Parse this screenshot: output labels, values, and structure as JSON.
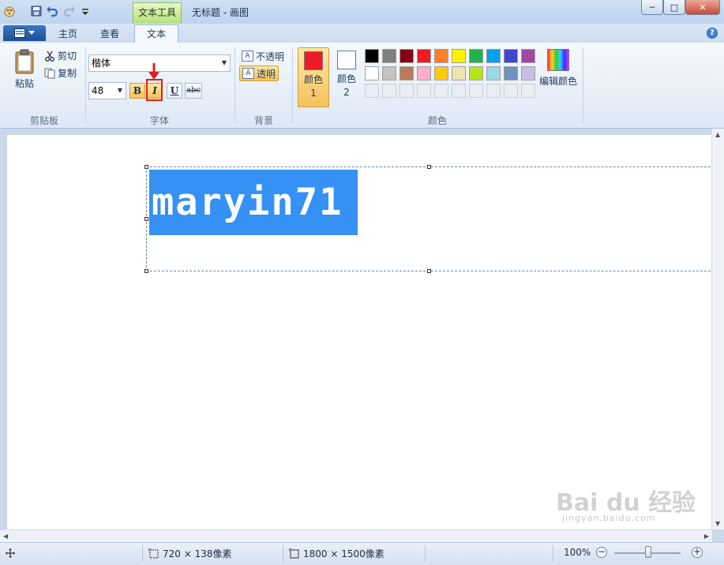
{
  "titlebar": {
    "context_tab": "文本工具",
    "title": "无标题 - 画图",
    "minimize": "─",
    "maximize": "□",
    "close": "✕"
  },
  "tabs": {
    "home": "主页",
    "view": "查看",
    "text": "文本"
  },
  "clipboard": {
    "paste": "粘贴",
    "cut": "剪切",
    "copy": "复制",
    "group": "剪贴板"
  },
  "font": {
    "family": "楷体",
    "size": "48",
    "bold": "B",
    "italic": "I",
    "underline": "U",
    "strike": "abc",
    "group": "字体"
  },
  "background": {
    "opaque": "不透明",
    "transparent": "透明",
    "group": "背景"
  },
  "colors": {
    "color1_label": "颜色 1",
    "color2_label": "颜色 2",
    "color1_value": "#ed1c24",
    "color2_value": "#ffffff",
    "edit": "编辑颜色",
    "group": "颜色",
    "palette_row1": [
      "#000000",
      "#7f7f7f",
      "#880015",
      "#ed1c24",
      "#ff7f27",
      "#fff200",
      "#22b14c",
      "#00a2e8",
      "#3f48cc",
      "#a349a4"
    ],
    "palette_row2": [
      "#ffffff",
      "#c3c3c3",
      "#b97a57",
      "#ffaec9",
      "#ffc90e",
      "#efe4b0",
      "#b5e61d",
      "#99d9ea",
      "#7092be",
      "#c8bfe7"
    ]
  },
  "canvas": {
    "text": "maryin71"
  },
  "status": {
    "selection_size": "720 × 138像素",
    "image_size": "1800 × 1500像素",
    "zoom": "100%"
  },
  "watermark": {
    "main": "Bai du 经验",
    "sub": "jingyan.baidu.com"
  }
}
